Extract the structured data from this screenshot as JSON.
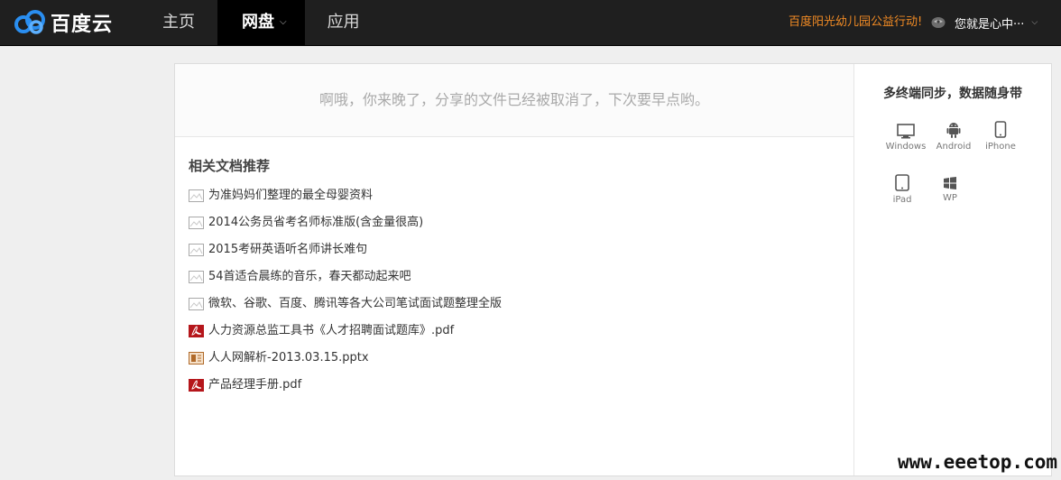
{
  "header": {
    "logo_text": "百度云",
    "nav": [
      {
        "label": "主页"
      },
      {
        "label": "网盘"
      },
      {
        "label": "应用"
      }
    ],
    "promo": "百度阳光幼儿园公益行动!",
    "user_name": "您就是心中···",
    "colors": {
      "bar": "#1f1f1f",
      "promo": "#f08a24"
    }
  },
  "main": {
    "notice": "啊哦，你来晚了，分享的文件已经被取消了，下次要早点哟。",
    "recommend_title": "相关文档推荐",
    "docs": [
      {
        "title": "为准妈妈们整理的最全母婴资料",
        "icon": "doc-icon"
      },
      {
        "title": "2014公务员省考名师标准版(含金量很高)",
        "icon": "doc-icon"
      },
      {
        "title": "2015考研英语听名师讲长难句",
        "icon": "doc-icon"
      },
      {
        "title": "54首适合晨练的音乐，春天都动起来吧",
        "icon": "doc-icon"
      },
      {
        "title": "微软、谷歌、百度、腾讯等各大公司笔试面试题整理全版",
        "icon": "doc-icon"
      },
      {
        "title": "人力资源总监工具书《人才招聘面试题库》.pdf",
        "icon": "pdf-icon"
      },
      {
        "title": "人人网解析-2013.03.15.pptx",
        "icon": "ppt-icon"
      },
      {
        "title": "产品经理手册.pdf",
        "icon": "pdf-icon"
      }
    ]
  },
  "sidebar": {
    "title": "多终端同步，数据随身带",
    "devices": [
      {
        "label": "Windows",
        "icon": "monitor-icon"
      },
      {
        "label": "Android",
        "icon": "android-icon"
      },
      {
        "label": "iPhone",
        "icon": "phone-icon"
      },
      {
        "label": "iPad",
        "icon": "tablet-icon"
      },
      {
        "label": "WP",
        "icon": "windows-logo-icon"
      }
    ]
  },
  "watermark": "www.eeetop.com"
}
